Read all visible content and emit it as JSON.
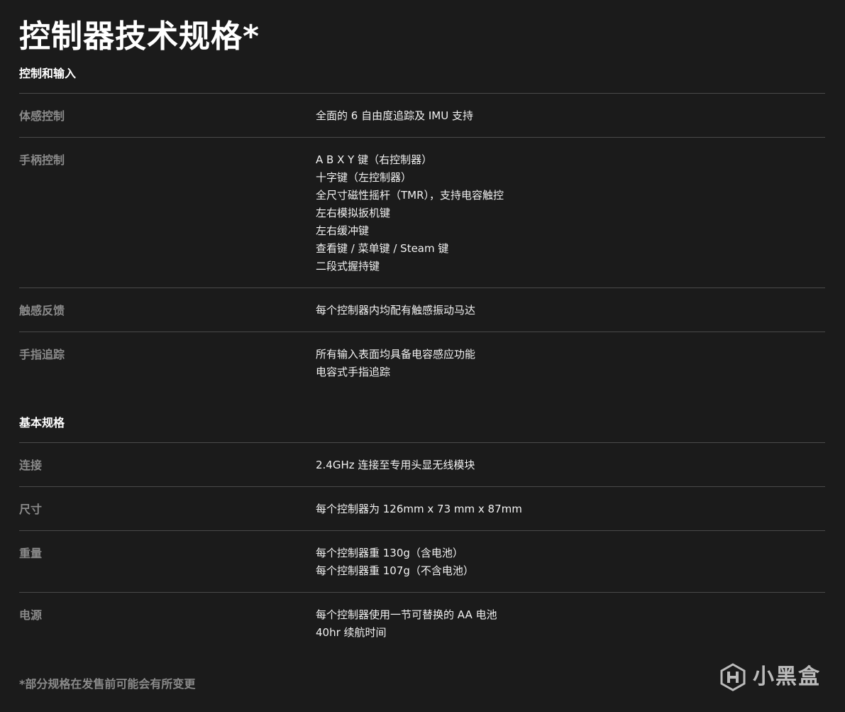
{
  "page_title": "控制器技术规格*",
  "sections": [
    {
      "heading": "控制和输入",
      "rows": [
        {
          "label": "体感控制",
          "values": [
            "全面的 6 自由度追踪及 IMU 支持"
          ]
        },
        {
          "label": "手柄控制",
          "values": [
            "A B X Y 键（右控制器）",
            "十字键（左控制器）",
            "全尺寸磁性摇杆（TMR），支持电容触控",
            "左右模拟扳机键",
            "左右缓冲键",
            "查看键 / 菜单键 / Steam 键",
            "二段式握持键"
          ]
        },
        {
          "label": "触感反馈",
          "values": [
            "每个控制器内均配有触感振动马达"
          ]
        },
        {
          "label": "手指追踪",
          "values": [
            "所有输入表面均具备电容感应功能",
            "电容式手指追踪"
          ]
        }
      ]
    },
    {
      "heading": "基本规格",
      "rows": [
        {
          "label": "连接",
          "values": [
            "2.4GHz 连接至专用头显无线模块"
          ]
        },
        {
          "label": "尺寸",
          "values": [
            "每个控制器为 126mm x 73 mm x 87mm"
          ]
        },
        {
          "label": "重量",
          "values": [
            "每个控制器重 130g（含电池）",
            "每个控制器重 107g（不含电池）"
          ]
        },
        {
          "label": "电源",
          "values": [
            "每个控制器使用一节可替换的 AA 电池",
            "40hr 续航时间"
          ]
        }
      ]
    }
  ],
  "footnote": "*部分规格在发售前可能会有所变更",
  "watermark": {
    "icon": "heybox-logo-icon",
    "text": "小黑盒"
  },
  "colors": {
    "background": "#1b1b1b",
    "title": "#ffffff",
    "label": "#8a8a8a",
    "value": "#f2f2f2",
    "divider": "#4a4a4a"
  }
}
